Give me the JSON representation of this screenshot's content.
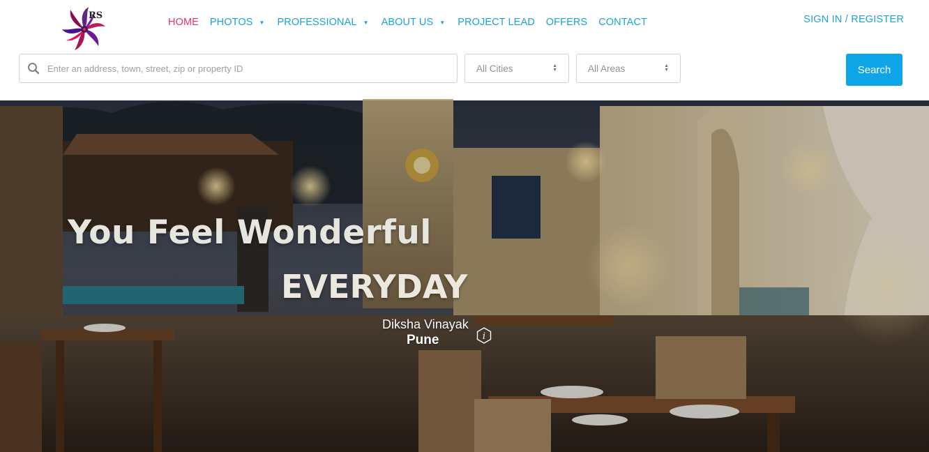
{
  "brand": {
    "logo_text": "RS"
  },
  "nav": {
    "items": [
      {
        "label": "HOME",
        "active": true,
        "dropdown": false
      },
      {
        "label": "PHOTOS",
        "active": false,
        "dropdown": true
      },
      {
        "label": "PROFESSIONAL",
        "active": false,
        "dropdown": true
      },
      {
        "label": "ABOUT US",
        "active": false,
        "dropdown": true
      },
      {
        "label": "PROJECT LEAD",
        "active": false,
        "dropdown": false
      },
      {
        "label": "OFFERS",
        "active": false,
        "dropdown": false
      },
      {
        "label": "CONTACT",
        "active": false,
        "dropdown": false
      }
    ],
    "signin": "SIGN IN / REGISTER"
  },
  "search": {
    "placeholder": "Enter an address, town, street, zip or property ID",
    "cities": "All Cities",
    "areas": "All Areas",
    "button": "Search"
  },
  "hero": {
    "title": "You Feel Wonderful",
    "subtitle": "EVERYDAY",
    "owner": "Diksha Vinayak",
    "city": "Pune"
  },
  "colors": {
    "accent": "#1aa3d6",
    "active": "#e4327a",
    "button": "#0ea5e9"
  }
}
